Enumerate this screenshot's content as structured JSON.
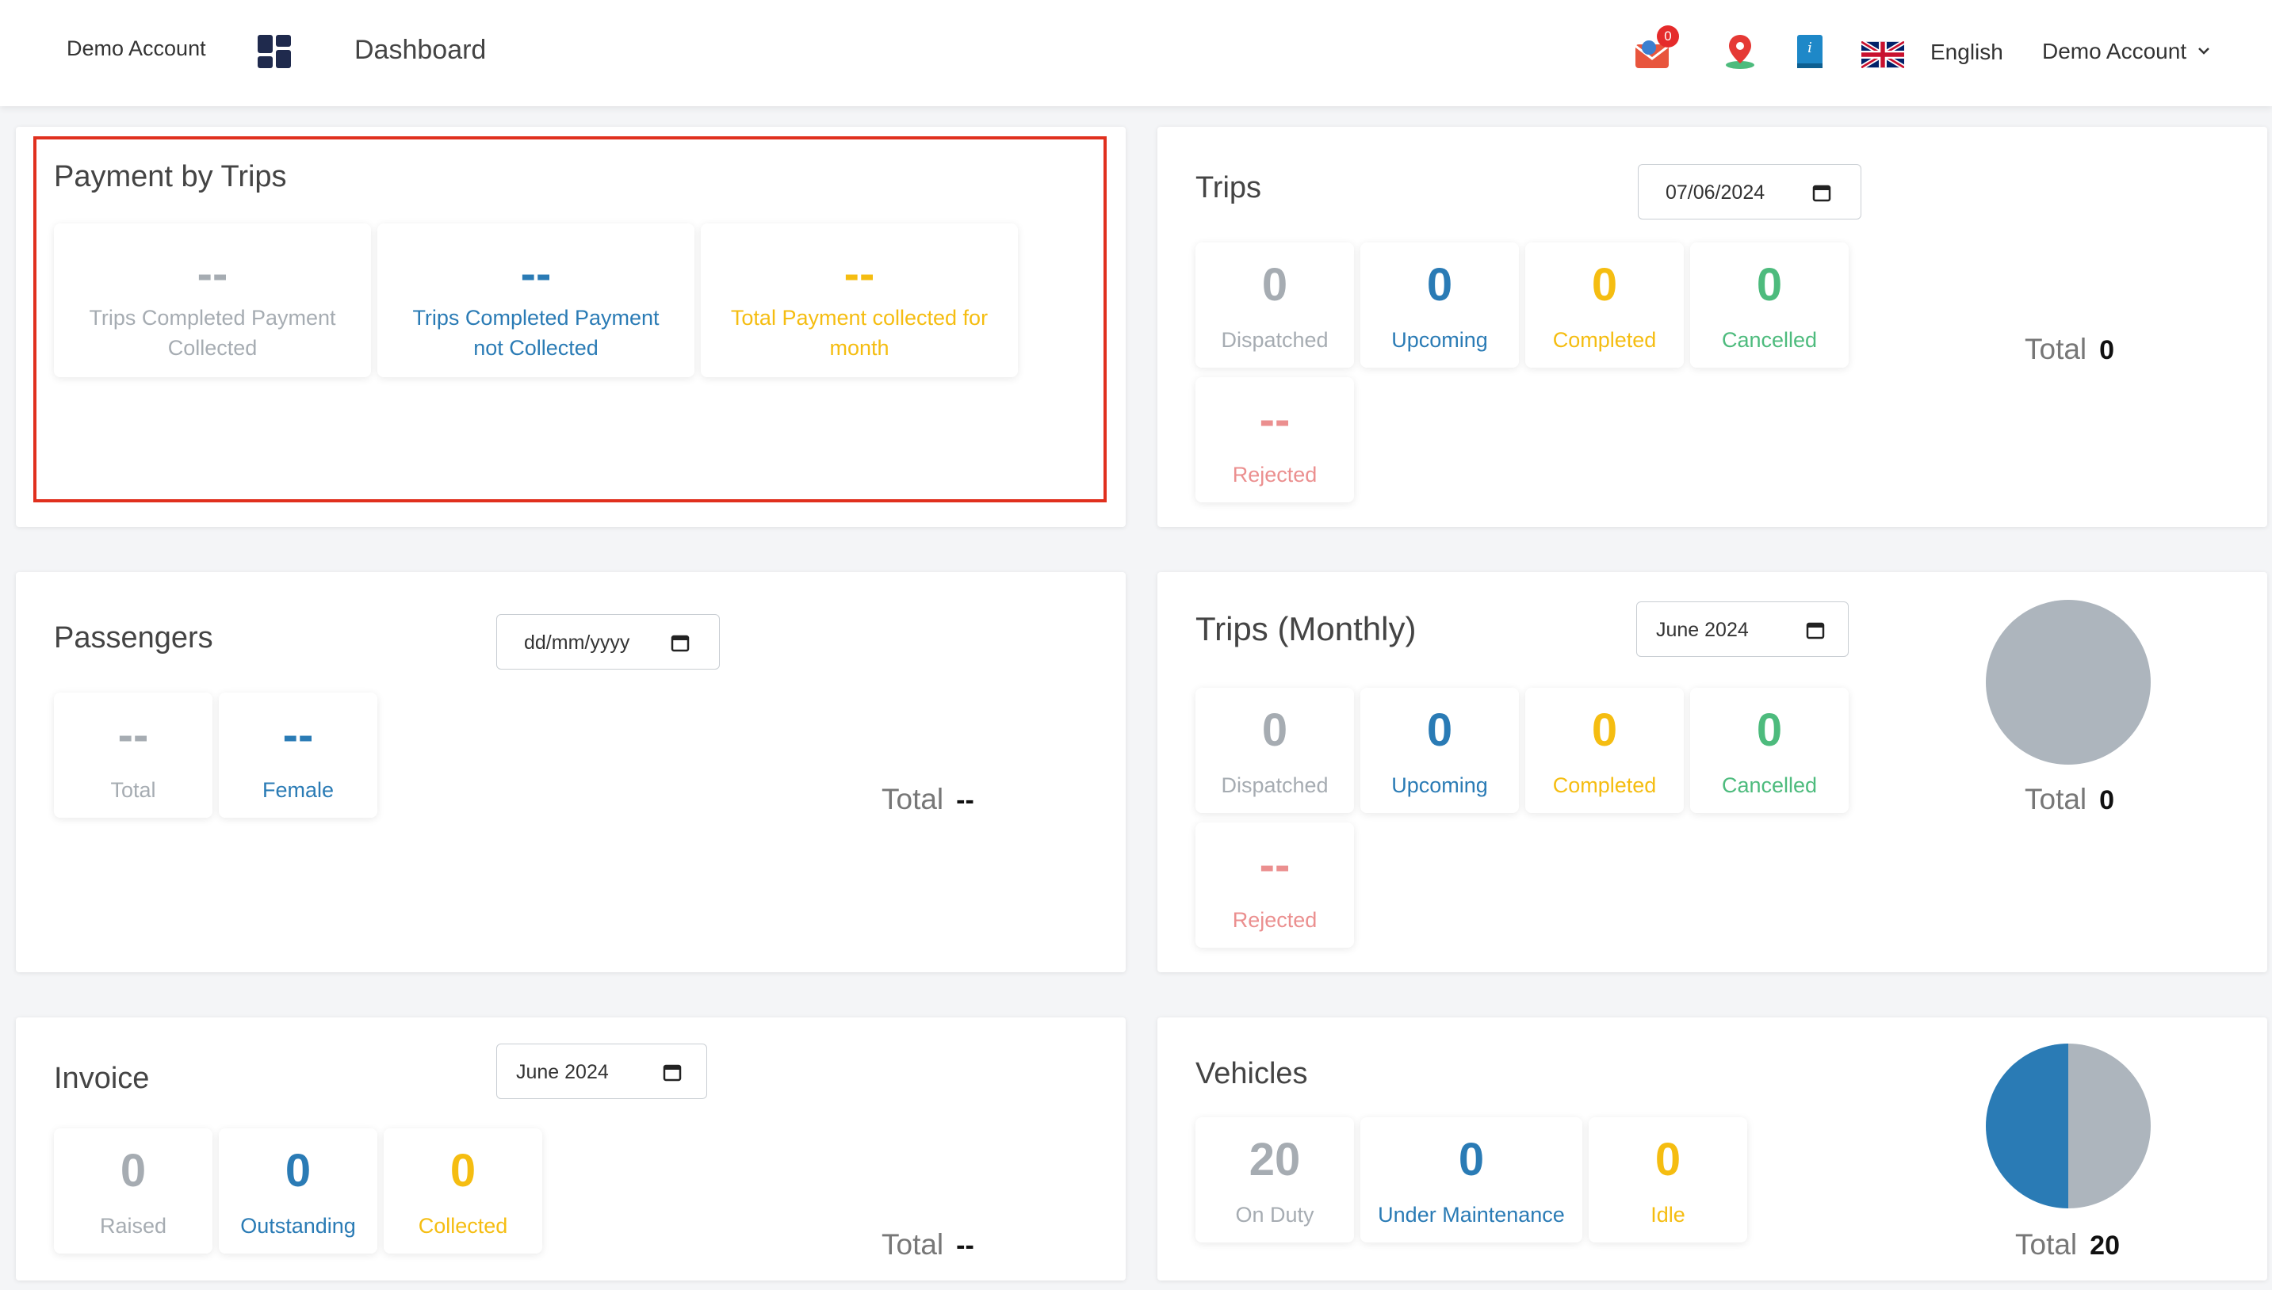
{
  "header": {
    "brand": "Demo Account",
    "title": "Dashboard",
    "notifications_count": "0",
    "language": "English",
    "account": "Demo Account",
    "icons": [
      "grid-icon",
      "mail-icon",
      "map-pin-icon",
      "info-book-icon",
      "uk-flag-icon",
      "chevron-down-icon"
    ]
  },
  "payment": {
    "title": "Payment by Trips",
    "stats": [
      {
        "value": "--",
        "label": "Trips Completed Payment Collected",
        "color": "#a6acb2"
      },
      {
        "value": "--",
        "label": "Trips Completed Payment not Collected",
        "color": "#2a7bb5"
      },
      {
        "value": "--",
        "label": "Total Payment collected for month",
        "color": "#f5bd11"
      }
    ]
  },
  "trips": {
    "title": "Trips",
    "date": "07/06/2024",
    "stats": [
      {
        "value": "0",
        "label": "Dispatched"
      },
      {
        "value": "0",
        "label": "Upcoming"
      },
      {
        "value": "0",
        "label": "Completed"
      },
      {
        "value": "0",
        "label": "Cancelled"
      },
      {
        "value": "--",
        "label": "Rejected"
      }
    ],
    "total_label": "Total",
    "total_value": "0"
  },
  "passengers": {
    "title": "Passengers",
    "date_placeholder": "dd/mm/yyyy",
    "stats": [
      {
        "value": "--",
        "label": "Total"
      },
      {
        "value": "--",
        "label": "Female"
      }
    ],
    "total_label": "Total",
    "total_value": "--"
  },
  "trips_monthly": {
    "title": "Trips (Monthly)",
    "month": "June 2024",
    "stats": [
      {
        "value": "0",
        "label": "Dispatched"
      },
      {
        "value": "0",
        "label": "Upcoming"
      },
      {
        "value": "0",
        "label": "Completed"
      },
      {
        "value": "0",
        "label": "Cancelled"
      },
      {
        "value": "--",
        "label": "Rejected"
      }
    ],
    "total_label": "Total",
    "total_value": "0"
  },
  "invoice": {
    "title": "Invoice",
    "month": "June 2024",
    "stats": [
      {
        "value": "0",
        "label": "Raised"
      },
      {
        "value": "0",
        "label": "Outstanding"
      },
      {
        "value": "0",
        "label": "Collected"
      }
    ],
    "total_label": "Total",
    "total_value": "--"
  },
  "vehicles": {
    "title": "Vehicles",
    "stats": [
      {
        "value": "20",
        "label": "On Duty"
      },
      {
        "value": "0",
        "label": "Under Maintenance"
      },
      {
        "value": "0",
        "label": "Idle"
      }
    ],
    "total_label": "Total",
    "total_value": "20"
  },
  "colors": {
    "gray": "#a6acb2",
    "blue": "#2a7bb5",
    "yellow": "#f5bd11",
    "green": "#4dbb7d",
    "red": "#eb8f8f",
    "highlight": "#e0301e"
  }
}
